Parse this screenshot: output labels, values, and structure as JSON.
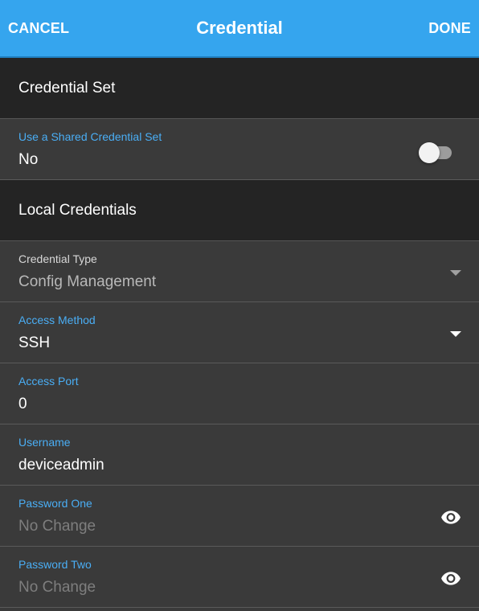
{
  "header": {
    "cancel_label": "CANCEL",
    "title": "Credential",
    "done_label": "DONE"
  },
  "sections": {
    "credential_set": "Credential Set",
    "local_credentials": "Local Credentials"
  },
  "shared_set": {
    "label": "Use a Shared Credential Set",
    "value": "No",
    "toggle_on": false
  },
  "credential_type": {
    "label": "Credential Type",
    "value": "Config Management"
  },
  "access_method": {
    "label": "Access Method",
    "value": "SSH"
  },
  "access_port": {
    "label": "Access Port",
    "value": "0"
  },
  "username": {
    "label": "Username",
    "value": "deviceadmin"
  },
  "password_one": {
    "label": "Password One",
    "placeholder": "No Change"
  },
  "password_two": {
    "label": "Password Two",
    "placeholder": "No Change"
  },
  "colors": {
    "accent": "#35a5ee",
    "label_blue": "#4aaef5",
    "section_bg": "#242424",
    "field_bg": "#3a3a3a"
  },
  "icons": {
    "password_toggle": "eye-icon",
    "dropdown": "chevron-down-icon"
  }
}
